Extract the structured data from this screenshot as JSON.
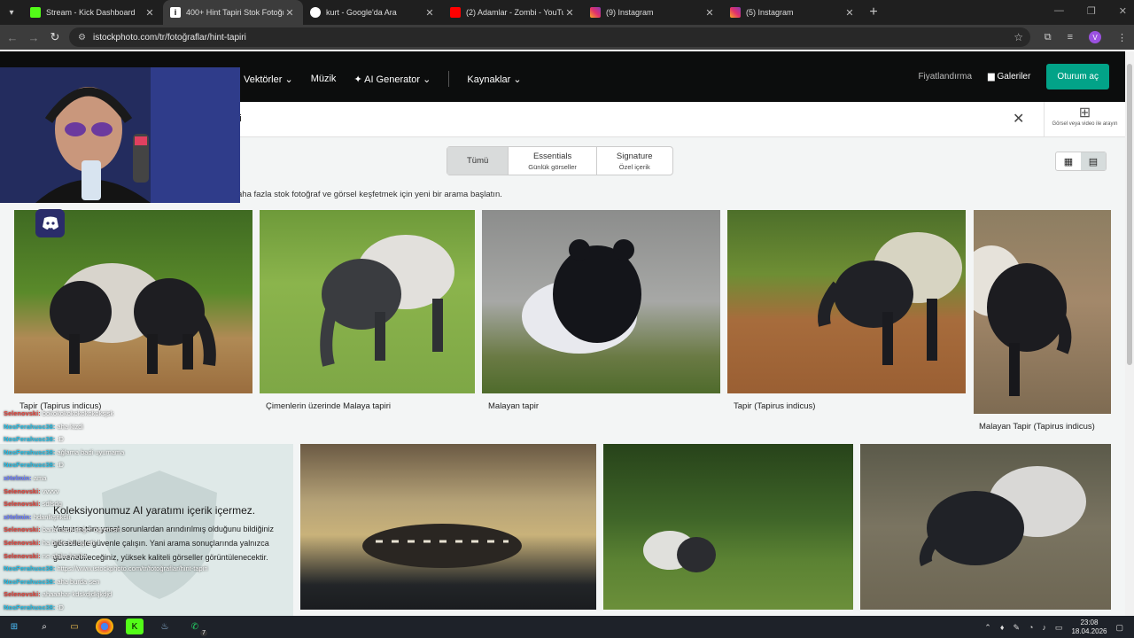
{
  "browser": {
    "tabs": [
      {
        "label": "Stream - Kick Dashboard",
        "color": "#53fc18"
      },
      {
        "label": "400+ Hint Tapiri Stok Fotoğrafla",
        "color": "#e8e8e8"
      },
      {
        "label": "kurt - Google'da Ara",
        "color": "#4285f4"
      },
      {
        "label": "(2) Adamlar - Zombi - YouTube",
        "color": "#ff0000"
      },
      {
        "label": "(9) Instagram",
        "color": "#e1306c"
      },
      {
        "label": "(5) Instagram",
        "color": "#e1306c"
      }
    ],
    "url": "istockphoto.com/tr/fotoğraflar/hint-tapiri",
    "profile_initial": "V"
  },
  "site": {
    "nav": [
      "Vektörler",
      "Müzik",
      "AI Generator",
      "Kaynaklar"
    ],
    "pricing": "Fiyatlandırma",
    "galleries": "Galeriler",
    "login": "Oturum aç",
    "search_query": "piri",
    "image_search_label": "Görsel veya video ile arayın"
  },
  "filters": {
    "all": "Tümü",
    "essentials": "Essentials",
    "essentials_sub": "Günlük görseller",
    "signature": "Signature",
    "signature_sub": "Özel içerik"
  },
  "hint": "aha fazla stok fotoğraf ve görsel keşfetmek için yeni bir arama başlatın.",
  "photos": {
    "row1": [
      {
        "caption": "Tapir (Tapirus indicus)"
      },
      {
        "caption": "Çimenlerin üzerinde Malaya tapiri"
      },
      {
        "caption": "Malayan tapir"
      },
      {
        "caption": "Tapir (Tapirus indicus)"
      },
      {
        "caption": "Malayan Tapir (Tapirus indicus)"
      }
    ]
  },
  "ai_panel": {
    "heading": "Koleksiyonumuz AI yaratımı içerik içermez.",
    "body": "Yalnızca tüm yasal sorunlardan arındırılmış olduğunu bildiğiniz görsellerle güvenle çalışın. Yani arama sonuçlarında yalnızca güvenebileceğiniz, yüksek kaliteli görseller görüntülenecektir."
  },
  "chat": [
    {
      "user": "Selenovski:",
      "msg": "bokokokokokokokoksjsk",
      "cls": "u1"
    },
    {
      "user": "NosFerahusc38:",
      "msg": "aha kizdi",
      "cls": "u2"
    },
    {
      "user": "NosFerahusc38:",
      "msg": ":D",
      "cls": "u2"
    },
    {
      "user": "NosFerahusc38:",
      "msg": "ağlama badi uyumama",
      "cls": "u2"
    },
    {
      "user": "NosFerahusc38:",
      "msg": ":D",
      "cls": "u2"
    },
    {
      "user": "xHelmin:",
      "msg": "ama",
      "cls": "u3"
    },
    {
      "user": "Selenovski:",
      "msg": "vvvvv",
      "cls": "u1"
    },
    {
      "user": "Selenovski:",
      "msg": "sdfsdg",
      "cls": "u1"
    },
    {
      "user": "xHelmin:",
      "msg": "hdanlkşnkdlı",
      "cls": "u3"
    },
    {
      "user": "Selenovski:",
      "msg": "bana nasıl değer ögretirsin",
      "cls": "u1"
    },
    {
      "user": "Selenovski:",
      "msg": "ha birde bu ögretir",
      "cls": "u1"
    },
    {
      "user": "Selenovski:",
      "msg": "ne alaka kanka",
      "cls": "u1"
    },
    {
      "user": "NosFerahusc38:",
      "msg": "https://www.istockphoto.com/tr/fotoğraflar/hint-tapiri",
      "cls": "u2"
    },
    {
      "user": "NosFerahusc38:",
      "msg": "aha burda sen",
      "cls": "u2"
    },
    {
      "user": "Selenovski:",
      "msg": "ahaaahar kdskdjdkjkdjd",
      "cls": "u1"
    },
    {
      "user": "NosFerahusc38:",
      "msg": ":D",
      "cls": "u2"
    },
    {
      "user": "Selenovski:",
      "msg": "haydaaaa",
      "cls": "u1"
    },
    {
      "user": "xHelmin:",
      "msg": "harbi su samurları çok tatlı",
      "cls": "u3"
    }
  ],
  "taskbar": {
    "time": "23:08",
    "date": "18.04.2026",
    "whatsapp_badge": "7"
  }
}
